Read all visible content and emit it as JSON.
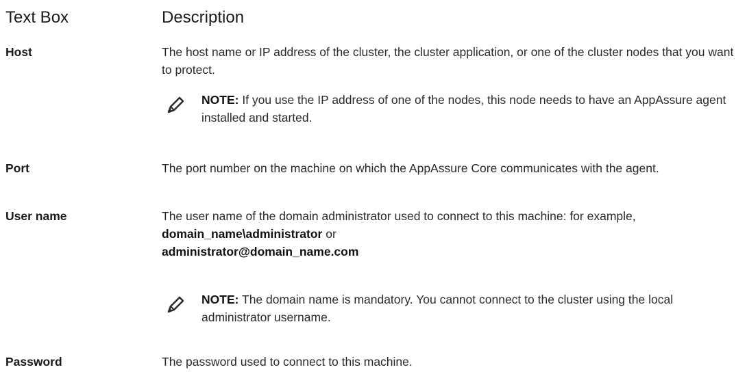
{
  "header": {
    "col1": "Text Box",
    "col2": "Description"
  },
  "rows": [
    {
      "term": "Host",
      "desc": "The host name or IP address of the cluster, the cluster application, or one of the cluster nodes that you want to protect.",
      "note_label": "NOTE:",
      "note_text": " If you use the IP address of one of the nodes, this node needs to have an AppAssure agent installed and started."
    },
    {
      "term": "Port",
      "desc": "The port number on the machine on which the AppAssure Core communicates with the agent."
    },
    {
      "term": "User name",
      "desc_a": "The user name of the domain administrator used to connect to this machine: for example, ",
      "desc_b": "domain_name\\administrator",
      "desc_c": " or ",
      "desc_d": "administrator@domain_name.com",
      "note_label": "NOTE:",
      "note_text": " The domain name is mandatory. You cannot connect to the cluster using the local administrator username."
    },
    {
      "term": "Password",
      "desc": "The password used to connect to this machine."
    }
  ],
  "icons": {
    "note": "pencil-note-icon"
  }
}
